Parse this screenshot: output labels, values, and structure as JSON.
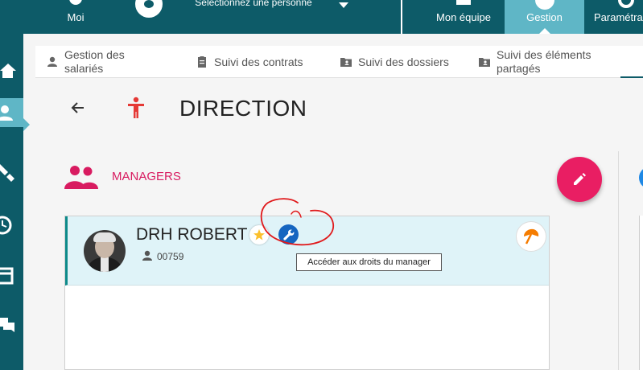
{
  "topbar": {
    "moi_label": "Moi",
    "person_select_label": "Sélectionnez une personne",
    "equipe_label": "Mon équipe",
    "gestion_label": "Gestion",
    "param_label": "Paramétra"
  },
  "tabs": [
    {
      "label": "Gestion des salariés",
      "icon": "person-icon"
    },
    {
      "label": "Suivi des contrats",
      "icon": "clipboard-icon"
    },
    {
      "label": "Suivi des dossiers",
      "icon": "folder-person-icon"
    },
    {
      "label": "Suivi des éléments partagés",
      "icon": "folder-shared-icon"
    }
  ],
  "page": {
    "title": "DIRECTION"
  },
  "managers": {
    "section_label": "MANAGERS",
    "card": {
      "name": "DRH ROBERT",
      "employee_id": "00759"
    }
  },
  "tooltip": {
    "text": "Accéder aux droits du manager"
  },
  "colors": {
    "primary": "#0d5b68",
    "active_tab": "#5fb6c6",
    "accent": "#e91e63",
    "wrench_button": "#1565c0",
    "annotation": "#e0191b"
  }
}
